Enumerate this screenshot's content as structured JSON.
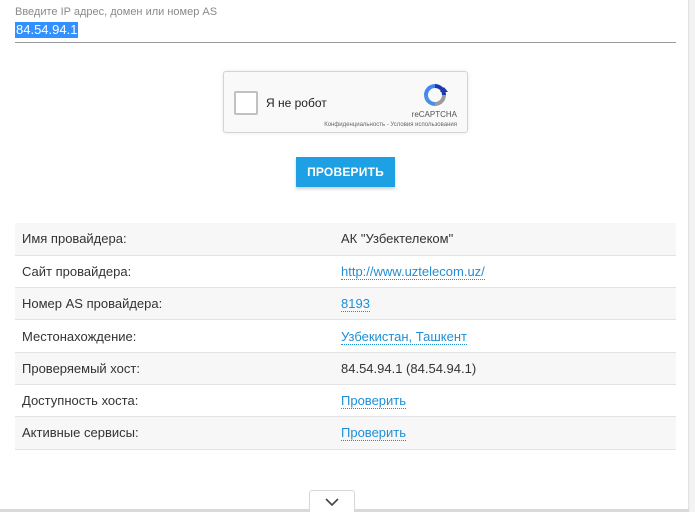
{
  "search": {
    "label": "Введите IP адрес, домен или номер AS",
    "value": "84.54.94.1"
  },
  "captcha": {
    "label": "Я не робот",
    "brand": "reCAPTCHA",
    "terms": "Конфиденциальность - Условия использования"
  },
  "check_button": "ПРОВЕРИТЬ",
  "info": {
    "rows": [
      {
        "key": "Имя провайдера:",
        "value": "АК \"Узбектелеком\"",
        "link": false
      },
      {
        "key": "Сайт провайдера:",
        "value": "http://www.uztelecom.uz/",
        "link": true
      },
      {
        "key": "Номер AS провайдера:",
        "value": "8193",
        "link": true
      },
      {
        "key": "Местонахождение:",
        "value": "Узбекистан, Ташкент",
        "link": true
      },
      {
        "key": "Проверяемый хост:",
        "value": "84.54.94.1 (84.54.94.1)",
        "link": false
      },
      {
        "key": "Доступность хоста:",
        "value": "Проверить",
        "link": true
      },
      {
        "key": "Активные сервисы:",
        "value": "Проверить",
        "link": true
      }
    ]
  },
  "icons": {
    "recaptcha": "recaptcha-logo-icon",
    "scroll": "chevron-down-icon"
  },
  "colors": {
    "accent": "#1ea0e4",
    "link": "#1e8fd6",
    "selection": "#3390ff"
  }
}
